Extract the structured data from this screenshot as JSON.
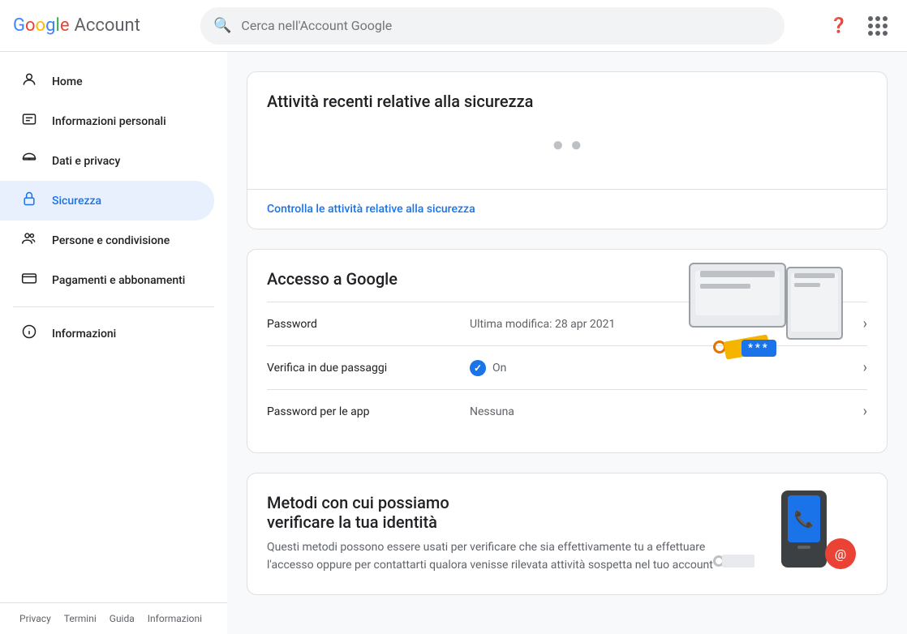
{
  "header": {
    "logo_google": "Google",
    "logo_account": "Account",
    "search_placeholder": "Cerca nell'Account Google"
  },
  "sidebar": {
    "items": [
      {
        "id": "home",
        "label": "Home",
        "icon": "👤"
      },
      {
        "id": "personal",
        "label": "Informazioni personali",
        "icon": "🪪"
      },
      {
        "id": "privacy",
        "label": "Dati e privacy",
        "icon": "🔘"
      },
      {
        "id": "security",
        "label": "Sicurezza",
        "icon": "🔒",
        "active": true
      },
      {
        "id": "people",
        "label": "Persone e condivisione",
        "icon": "👥"
      },
      {
        "id": "payments",
        "label": "Pagamenti e abbonamenti",
        "icon": "💳"
      },
      {
        "id": "info",
        "label": "Informazioni",
        "icon": "ℹ️"
      }
    ],
    "footer": [
      {
        "label": "Privacy"
      },
      {
        "label": "Termini"
      },
      {
        "label": "Guida"
      },
      {
        "label": "Informazioni"
      }
    ]
  },
  "main": {
    "security_activity": {
      "title": "Attività recenti relative alla sicurezza",
      "link_label": "Controlla le attività relative alla sicurezza"
    },
    "google_access": {
      "title": "Accesso a Google",
      "rows": [
        {
          "label": "Password",
          "value": "Ultima modifica: 28 apr 2021",
          "has_badge": false
        },
        {
          "label": "Verifica in due passaggi",
          "value": "On",
          "has_badge": true
        },
        {
          "label": "Password per le app",
          "value": "Nessuna",
          "has_badge": false
        }
      ]
    },
    "identity": {
      "title": "Metodi con cui possiamo\nverificare la tua identità",
      "description": "Questi metodi possono essere usati per verificare che sia effettivamente tu a effettuare l'accesso oppure per contattarti qualora venisse rilevata attività sospetta nel tuo account"
    }
  }
}
